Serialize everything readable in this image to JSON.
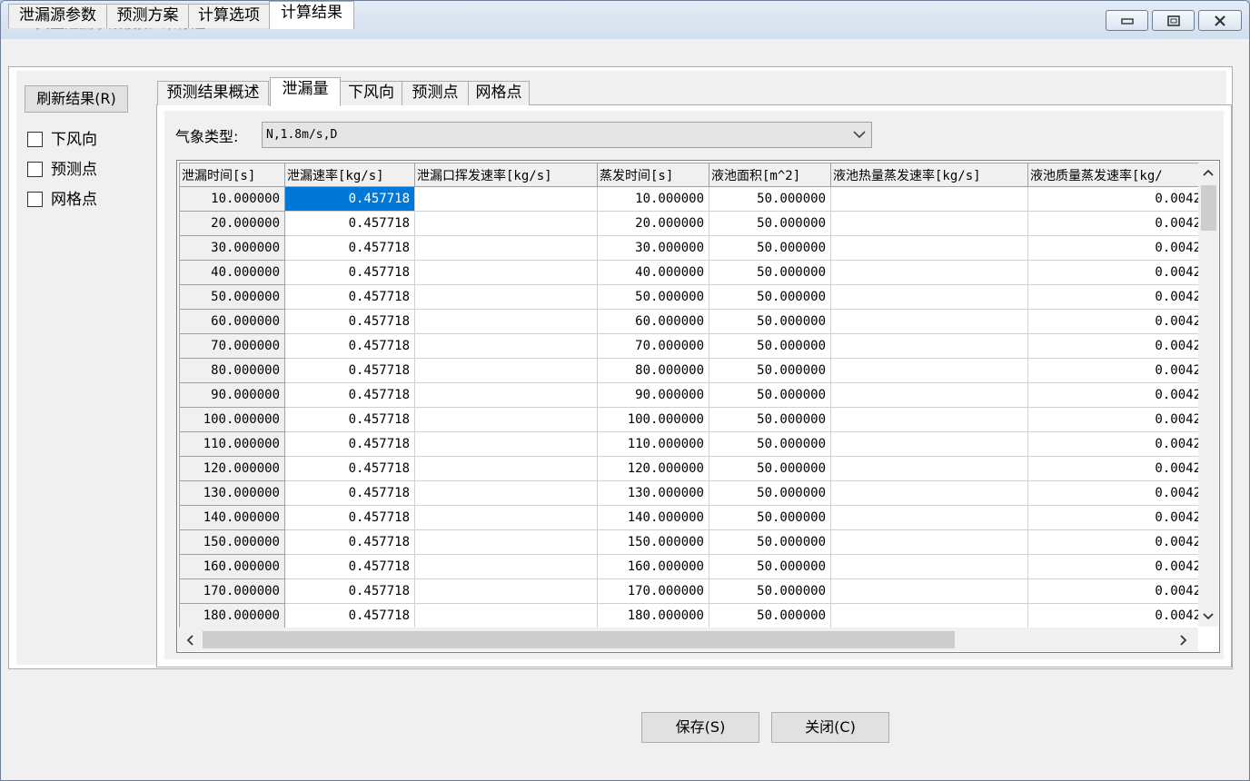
{
  "window": {
    "title": "典型泄漏事故模拟--未标题3"
  },
  "outer_tabs": [
    "泄漏源参数",
    "预测方案",
    "计算选项",
    "计算结果"
  ],
  "inner_tabs": [
    "预测结果概述",
    "泄漏量",
    "下风向",
    "预测点",
    "网格点"
  ],
  "sidebar": {
    "refresh_label": "刷新结果(R)",
    "checkboxes": [
      {
        "label": "下风向",
        "checked": false
      },
      {
        "label": "预测点",
        "checked": false
      },
      {
        "label": "网格点",
        "checked": false
      }
    ]
  },
  "weather": {
    "label": "气象类型:",
    "value": "N,1.8m/s,D"
  },
  "table": {
    "columns": [
      "泄漏时间[s]",
      "泄漏速率[kg/s]",
      "泄漏口挥发速率[kg/s]",
      "蒸发时间[s]",
      "液池面积[m^2]",
      "液池热量蒸发速率[kg/s]",
      "液池质量蒸发速率[kg/"
    ],
    "rows": [
      [
        "10.000000",
        "0.457718",
        "",
        "10.000000",
        "50.000000",
        "",
        "0.0042"
      ],
      [
        "20.000000",
        "0.457718",
        "",
        "20.000000",
        "50.000000",
        "",
        "0.0042"
      ],
      [
        "30.000000",
        "0.457718",
        "",
        "30.000000",
        "50.000000",
        "",
        "0.0042"
      ],
      [
        "40.000000",
        "0.457718",
        "",
        "40.000000",
        "50.000000",
        "",
        "0.0042"
      ],
      [
        "50.000000",
        "0.457718",
        "",
        "50.000000",
        "50.000000",
        "",
        "0.0042"
      ],
      [
        "60.000000",
        "0.457718",
        "",
        "60.000000",
        "50.000000",
        "",
        "0.0042"
      ],
      [
        "70.000000",
        "0.457718",
        "",
        "70.000000",
        "50.000000",
        "",
        "0.0042"
      ],
      [
        "80.000000",
        "0.457718",
        "",
        "80.000000",
        "50.000000",
        "",
        "0.0042"
      ],
      [
        "90.000000",
        "0.457718",
        "",
        "90.000000",
        "50.000000",
        "",
        "0.0042"
      ],
      [
        "100.000000",
        "0.457718",
        "",
        "100.000000",
        "50.000000",
        "",
        "0.0042"
      ],
      [
        "110.000000",
        "0.457718",
        "",
        "110.000000",
        "50.000000",
        "",
        "0.0042"
      ],
      [
        "120.000000",
        "0.457718",
        "",
        "120.000000",
        "50.000000",
        "",
        "0.0042"
      ],
      [
        "130.000000",
        "0.457718",
        "",
        "130.000000",
        "50.000000",
        "",
        "0.0042"
      ],
      [
        "140.000000",
        "0.457718",
        "",
        "140.000000",
        "50.000000",
        "",
        "0.0042"
      ],
      [
        "150.000000",
        "0.457718",
        "",
        "150.000000",
        "50.000000",
        "",
        "0.0042"
      ],
      [
        "160.000000",
        "0.457718",
        "",
        "160.000000",
        "50.000000",
        "",
        "0.0042"
      ],
      [
        "170.000000",
        "0.457718",
        "",
        "170.000000",
        "50.000000",
        "",
        "0.0042"
      ],
      [
        "180.000000",
        "0.457718",
        "",
        "180.000000",
        "50.000000",
        "",
        "0.0042"
      ]
    ]
  },
  "buttons": {
    "save": "保存(S)",
    "close": "关闭(C)"
  },
  "colors": {
    "selection": "#0078d7",
    "title_text": "#8a98ab",
    "app_icon": "#c0202a"
  }
}
